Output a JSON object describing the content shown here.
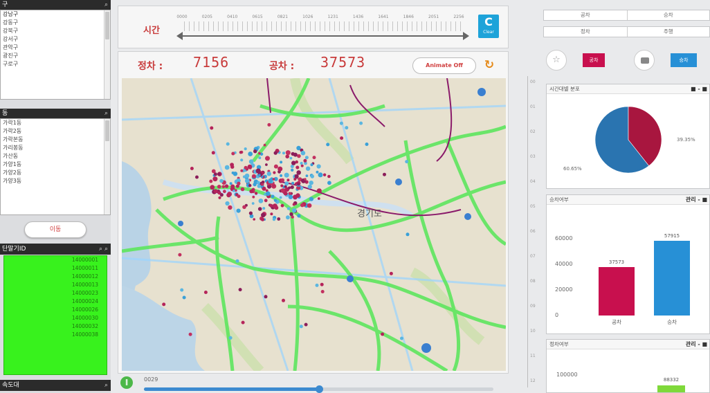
{
  "left": {
    "gu_header": "구",
    "gu_items": [
      "강남구",
      "강동구",
      "강북구",
      "강서구",
      "관악구",
      "광진구",
      "구로구"
    ],
    "dong_header": "동",
    "dong_items": [
      "가락1동",
      "가락2동",
      "가락본동",
      "가리봉동",
      "가산동",
      "가양1동",
      "가양2동",
      "가양3동"
    ],
    "move_button": "이동",
    "terminal_header": "단말기ID",
    "terminal_ids": [
      "14000001",
      "14000011",
      "14000012",
      "14000013",
      "14000023",
      "14000024",
      "14000026",
      "14000030",
      "14000032",
      "14000038"
    ],
    "speed_header": "속도대"
  },
  "timeline": {
    "label": "시간",
    "ticks": [
      "0000",
      "0205",
      "0410",
      "0615",
      "0821",
      "1026",
      "1231",
      "1436",
      "1641",
      "1846",
      "2051",
      "2256"
    ],
    "clear_label": "Clear"
  },
  "map": {
    "stopped_label": "정차 :",
    "stopped_value": "7156",
    "empty_label": "공차 :",
    "empty_value": "37573",
    "animate_button": "Animate Off",
    "place_label": "경기도"
  },
  "playbar": {
    "time": "0029",
    "progress": 0.5
  },
  "vruler": {
    "ticks": [
      "00",
      "01",
      "02",
      "03",
      "04",
      "05",
      "06",
      "07",
      "08",
      "09",
      "10",
      "11",
      "12"
    ]
  },
  "right": {
    "tabs1": [
      "공차",
      "승차"
    ],
    "tabs2": [
      "정차",
      "주행"
    ],
    "btn_pickup": "공차",
    "btn_drop": "승차",
    "pie_panel": {
      "title": "시간대별 분포",
      "controls": "■ - ■"
    },
    "bar_panel": {
      "title": "승차여부",
      "controls": "관리 - ■"
    },
    "bar_panel2": {
      "title": "정차여부",
      "controls": "관리 - ■",
      "axis_top": "100000",
      "value": "88332"
    }
  },
  "chart_data": [
    {
      "type": "pie",
      "title": "",
      "slices": [
        {
          "label": "60.65%",
          "value": 60.65,
          "color": "#2a74b0"
        },
        {
          "label": "39.35%",
          "value": 39.35,
          "color": "#a8163f"
        }
      ]
    },
    {
      "type": "bar",
      "title": "",
      "categories": [
        "공차",
        "승차"
      ],
      "values": [
        37573,
        57915
      ],
      "value_labels": [
        "37573",
        "57915"
      ],
      "colors": [
        "#c8104e",
        "#2790d6"
      ],
      "ylim": [
        0,
        70000
      ],
      "yticks": [
        "0",
        "20000",
        "40000",
        "60000"
      ]
    }
  ]
}
